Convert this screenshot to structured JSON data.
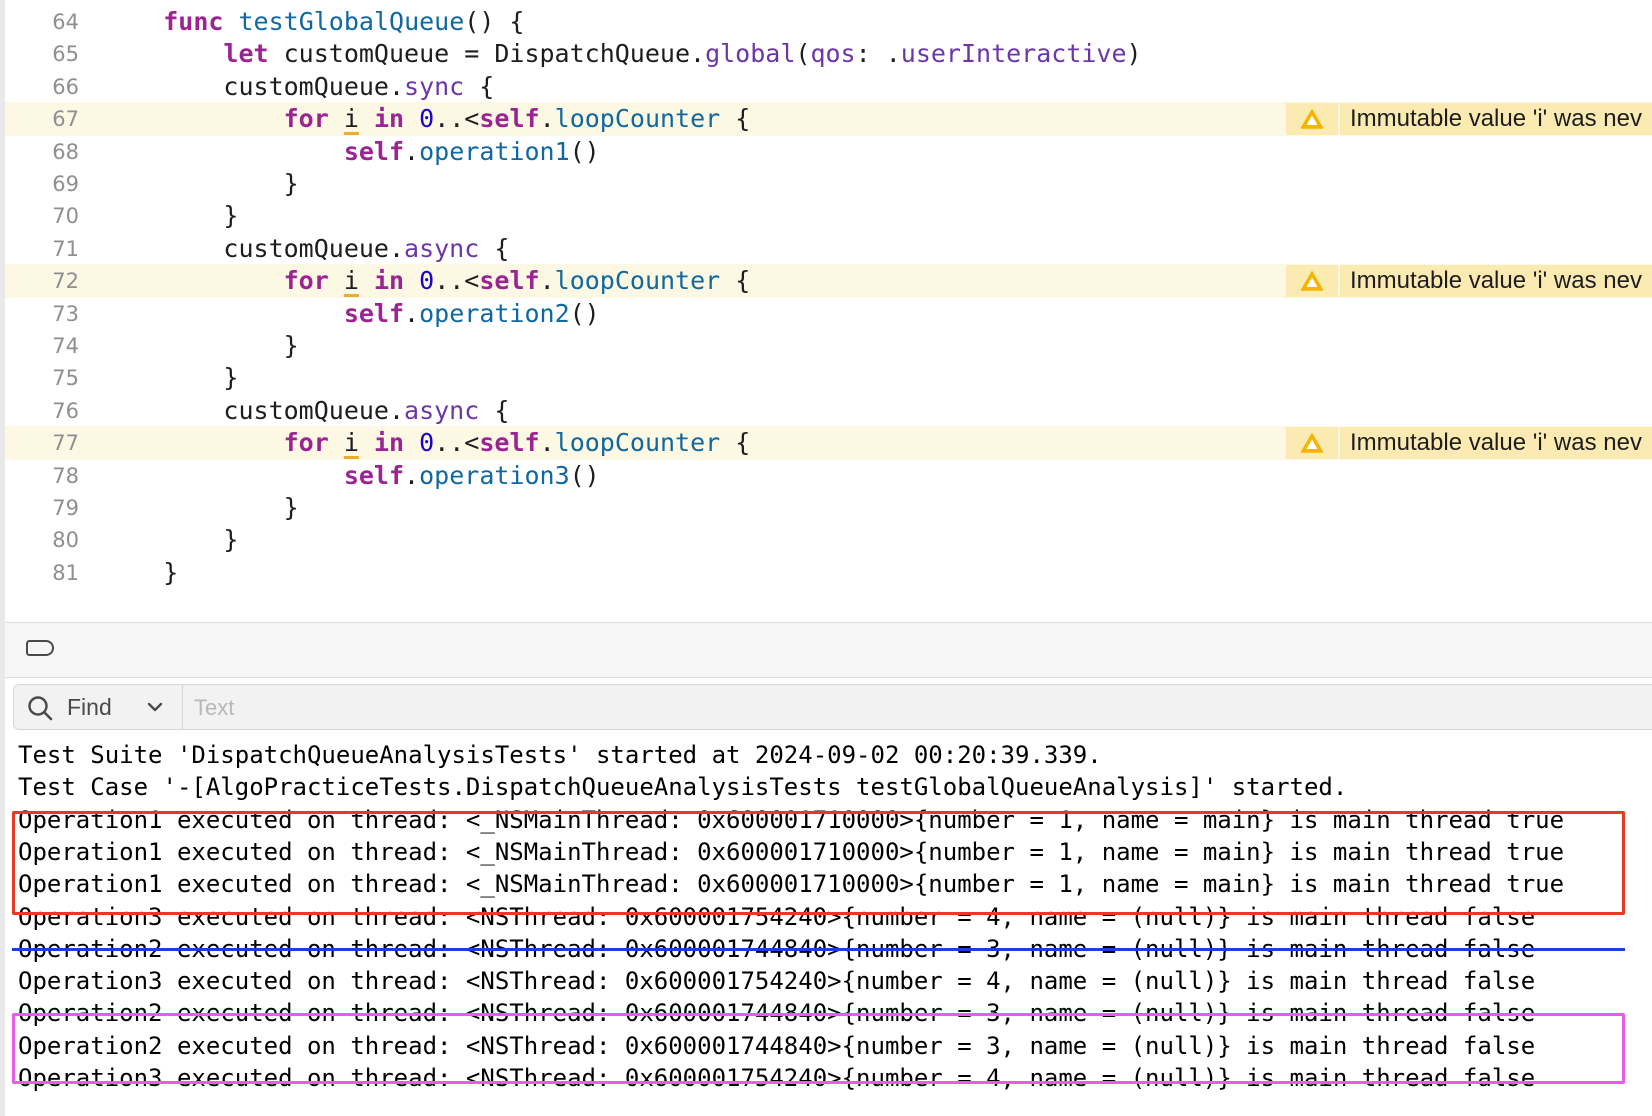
{
  "editor": {
    "lines": [
      {
        "num": "64",
        "warn": false,
        "tokens": [
          {
            "t": "    "
          },
          {
            "t": "func",
            "c": "kw"
          },
          {
            "t": " "
          },
          {
            "t": "testGlobalQueue",
            "c": "fn"
          },
          {
            "t": "() {"
          }
        ]
      },
      {
        "num": "65",
        "warn": false,
        "tokens": [
          {
            "t": "        "
          },
          {
            "t": "let",
            "c": "kw"
          },
          {
            "t": " customQueue = DispatchQueue."
          },
          {
            "t": "global",
            "c": "mem"
          },
          {
            "t": "("
          },
          {
            "t": "qos",
            "c": "mem"
          },
          {
            "t": ": ."
          },
          {
            "t": "userInteractive",
            "c": "mem"
          },
          {
            "t": ")"
          }
        ]
      },
      {
        "num": "66",
        "warn": false,
        "tokens": [
          {
            "t": "        customQueue."
          },
          {
            "t": "sync",
            "c": "mem"
          },
          {
            "t": " {"
          }
        ]
      },
      {
        "num": "67",
        "warn": true,
        "tokens": [
          {
            "t": "            "
          },
          {
            "t": "for",
            "c": "kw"
          },
          {
            "t": " "
          },
          {
            "t": "i",
            "c": "i-var"
          },
          {
            "t": " "
          },
          {
            "t": "in",
            "c": "kw"
          },
          {
            "t": " "
          },
          {
            "t": "0",
            "c": "num"
          },
          {
            "t": "..<"
          },
          {
            "t": "self",
            "c": "kw"
          },
          {
            "t": "."
          },
          {
            "t": "loopCounter",
            "c": "fn"
          },
          {
            "t": " {"
          }
        ]
      },
      {
        "num": "68",
        "warn": false,
        "tokens": [
          {
            "t": "                "
          },
          {
            "t": "self",
            "c": "kw"
          },
          {
            "t": "."
          },
          {
            "t": "operation1",
            "c": "fn"
          },
          {
            "t": "()"
          }
        ]
      },
      {
        "num": "69",
        "warn": false,
        "tokens": [
          {
            "t": "            }"
          }
        ]
      },
      {
        "num": "70",
        "warn": false,
        "tokens": [
          {
            "t": "        }"
          }
        ]
      },
      {
        "num": "71",
        "warn": false,
        "tokens": [
          {
            "t": "        customQueue."
          },
          {
            "t": "async",
            "c": "mem"
          },
          {
            "t": " {"
          }
        ]
      },
      {
        "num": "72",
        "warn": true,
        "tokens": [
          {
            "t": "            "
          },
          {
            "t": "for",
            "c": "kw"
          },
          {
            "t": " "
          },
          {
            "t": "i",
            "c": "i-var"
          },
          {
            "t": " "
          },
          {
            "t": "in",
            "c": "kw"
          },
          {
            "t": " "
          },
          {
            "t": "0",
            "c": "num"
          },
          {
            "t": "..<"
          },
          {
            "t": "self",
            "c": "kw"
          },
          {
            "t": "."
          },
          {
            "t": "loopCounter",
            "c": "fn"
          },
          {
            "t": " {"
          }
        ]
      },
      {
        "num": "73",
        "warn": false,
        "tokens": [
          {
            "t": "                "
          },
          {
            "t": "self",
            "c": "kw"
          },
          {
            "t": "."
          },
          {
            "t": "operation2",
            "c": "fn"
          },
          {
            "t": "()"
          }
        ]
      },
      {
        "num": "74",
        "warn": false,
        "tokens": [
          {
            "t": "            }"
          }
        ]
      },
      {
        "num": "75",
        "warn": false,
        "tokens": [
          {
            "t": "        }"
          }
        ]
      },
      {
        "num": "76",
        "warn": false,
        "tokens": [
          {
            "t": "        customQueue."
          },
          {
            "t": "async",
            "c": "mem"
          },
          {
            "t": " {"
          }
        ]
      },
      {
        "num": "77",
        "warn": true,
        "tokens": [
          {
            "t": "            "
          },
          {
            "t": "for",
            "c": "kw"
          },
          {
            "t": " "
          },
          {
            "t": "i",
            "c": "i-var"
          },
          {
            "t": " "
          },
          {
            "t": "in",
            "c": "kw"
          },
          {
            "t": " "
          },
          {
            "t": "0",
            "c": "num"
          },
          {
            "t": "..<"
          },
          {
            "t": "self",
            "c": "kw"
          },
          {
            "t": "."
          },
          {
            "t": "loopCounter",
            "c": "fn"
          },
          {
            "t": " {"
          }
        ]
      },
      {
        "num": "78",
        "warn": false,
        "tokens": [
          {
            "t": "                "
          },
          {
            "t": "self",
            "c": "kw"
          },
          {
            "t": "."
          },
          {
            "t": "operation3",
            "c": "fn"
          },
          {
            "t": "()"
          }
        ]
      },
      {
        "num": "79",
        "warn": false,
        "tokens": [
          {
            "t": "            }"
          }
        ]
      },
      {
        "num": "80",
        "warn": false,
        "tokens": [
          {
            "t": "        }"
          }
        ]
      },
      {
        "num": "81",
        "warn": false,
        "tokens": [
          {
            "t": "    }"
          }
        ]
      }
    ],
    "warning_message": "Immutable value 'i' was nev"
  },
  "find_bar": {
    "mode_label": "Find",
    "placeholder": "Text",
    "value": ""
  },
  "console": {
    "lines": [
      "Test Suite 'DispatchQueueAnalysisTests' started at 2024-09-02 00:20:39.339.",
      "Test Case '-[AlgoPracticeTests.DispatchQueueAnalysisTests testGlobalQueueAnalysis]' started.",
      "Operation1 executed on thread: <_NSMainThread: 0x600001710000>{number = 1, name = main} is main thread true",
      "Operation1 executed on thread: <_NSMainThread: 0x600001710000>{number = 1, name = main} is main thread true",
      "Operation1 executed on thread: <_NSMainThread: 0x600001710000>{number = 1, name = main} is main thread true",
      "Operation3 executed on thread: <NSThread: 0x600001754240>{number = 4, name = (null)} is main thread false",
      "Operation2 executed on thread: <NSThread: 0x600001744840>{number = 3, name = (null)} is main thread false",
      "Operation3 executed on thread: <NSThread: 0x600001754240>{number = 4, name = (null)} is main thread false",
      "Operation2 executed on thread: <NSThread: 0x600001744840>{number = 3, name = (null)} is main thread false",
      "Operation2 executed on thread: <NSThread: 0x600001744840>{number = 3, name = (null)} is main thread false",
      "Operation3 executed on thread: <NSThread: 0x600001754240>{number = 4, name = (null)} is main thread false"
    ]
  },
  "annotation_colors": {
    "red_box": "#e63b23",
    "blue_line": "#1a3fe0",
    "pink_box": "#e65ee6",
    "warning_bg": "#fbeab1",
    "warning_icon": "#f5b400"
  }
}
